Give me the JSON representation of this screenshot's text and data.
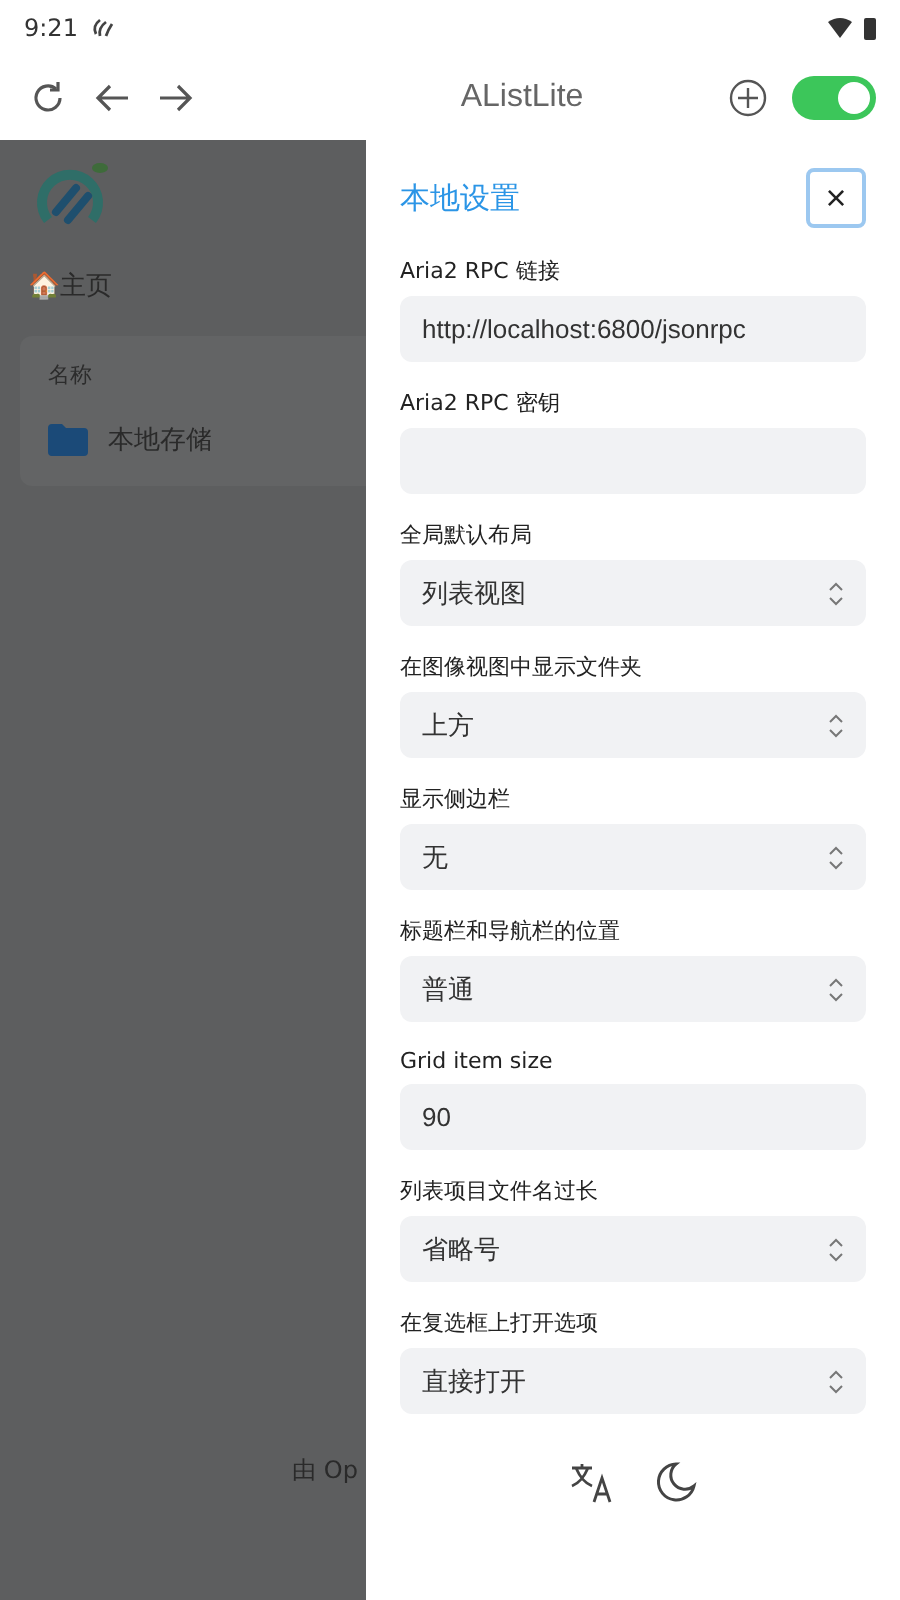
{
  "status_bar": {
    "time": "9:21"
  },
  "toolbar": {
    "title": "AListLite",
    "toggle": {
      "on": true
    }
  },
  "page": {
    "home_link": "🏠主页",
    "table": {
      "header": "名称",
      "rows": [
        {
          "name": "本地存储"
        }
      ]
    },
    "footer": "由 Op"
  },
  "drawer": {
    "title": "本地设置",
    "close": "×",
    "fields": [
      {
        "label": "Aria2 RPC 链接",
        "kind": "text",
        "value": "http://localhost:6800/jsonrpc"
      },
      {
        "label": "Aria2 RPC 密钥",
        "kind": "text"
      },
      {
        "label": "全局默认布局",
        "kind": "select",
        "value": "列表视图"
      },
      {
        "label": "在图像视图中显示文件夹",
        "kind": "select",
        "value": "上方"
      },
      {
        "label": "显示侧边栏",
        "kind": "select",
        "value": "无"
      },
      {
        "label": "标题栏和导航栏的位置",
        "kind": "select",
        "value": "普通"
      },
      {
        "label": "Grid item size",
        "kind": "text",
        "value": "90"
      },
      {
        "label": "列表项目文件名过长",
        "kind": "select",
        "value": "省略号"
      },
      {
        "label": "在复选框上打开选项",
        "kind": "select",
        "value": "直接打开"
      }
    ]
  }
}
